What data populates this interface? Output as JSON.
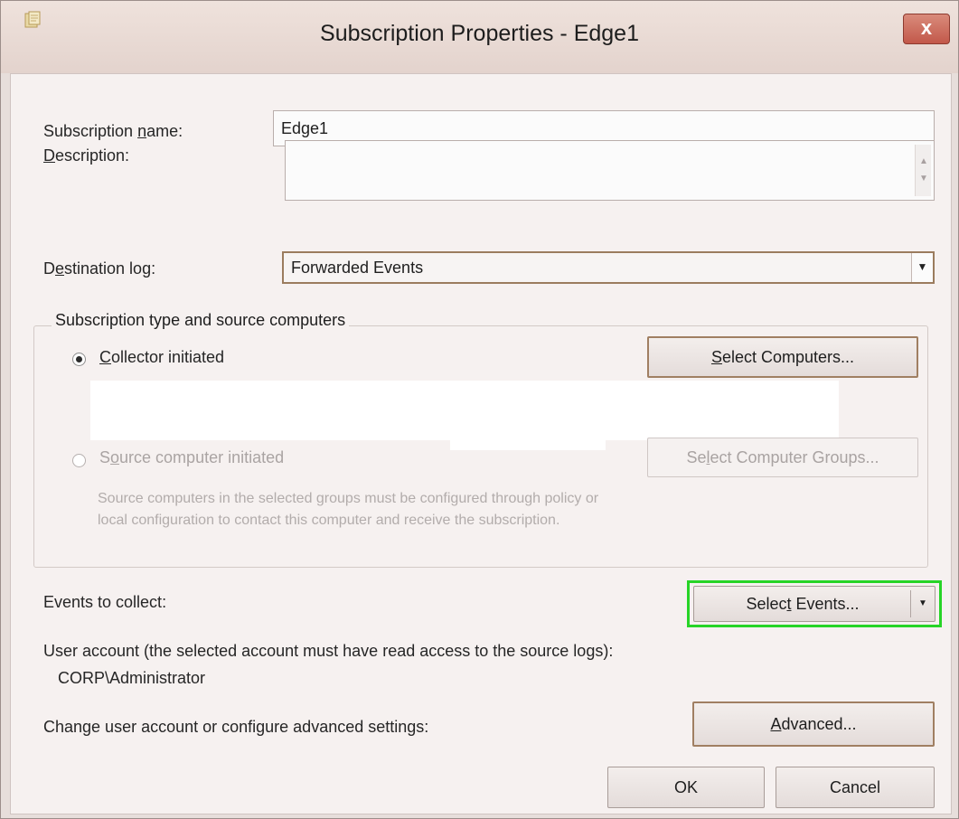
{
  "window": {
    "title": "Subscription Properties - Edge1",
    "close_glyph": "x",
    "icon": "subscription-app-icon"
  },
  "fields": {
    "name_label_pre": "Subscription ",
    "name_label_ul": "n",
    "name_label_post": "ame:",
    "name_value": "Edge1",
    "desc_label_ul": "D",
    "desc_label_post": "escription:",
    "desc_value": "",
    "dest_label_pre": "D",
    "dest_label_ul": "e",
    "dest_label_post": "stination log:",
    "dest_value": "Forwarded Events"
  },
  "subscription_type": {
    "group_title": "Subscription type and source computers",
    "collector_ul": "C",
    "collector_post": "ollector initiated",
    "collector_checked": true,
    "select_computers_pre": "",
    "select_computers_ul": "S",
    "select_computers_post": "elect Computers...",
    "source_pre": "S",
    "source_ul": "o",
    "source_post": "urce computer initiated",
    "source_checked": false,
    "select_groups_pre": "Se",
    "select_groups_ul": "l",
    "select_groups_post": "ect Computer Groups...",
    "source_hint_line1": "Source computers in the selected groups must be configured through policy or",
    "source_hint_line2": "local configuration to contact this computer and receive the subscription."
  },
  "events": {
    "label": "Events to collect:",
    "button_pre": "Selec",
    "button_ul": "t",
    "button_post": " Events...",
    "highlight_color": "#27d427"
  },
  "account": {
    "label": "User account (the selected account must have read access to the source logs):",
    "value": "CORP\\Administrator",
    "change_label": "Change user account or configure advanced settings:",
    "advanced_ul": "A",
    "advanced_post": "dvanced..."
  },
  "buttons": {
    "ok": "OK",
    "cancel": "Cancel"
  }
}
